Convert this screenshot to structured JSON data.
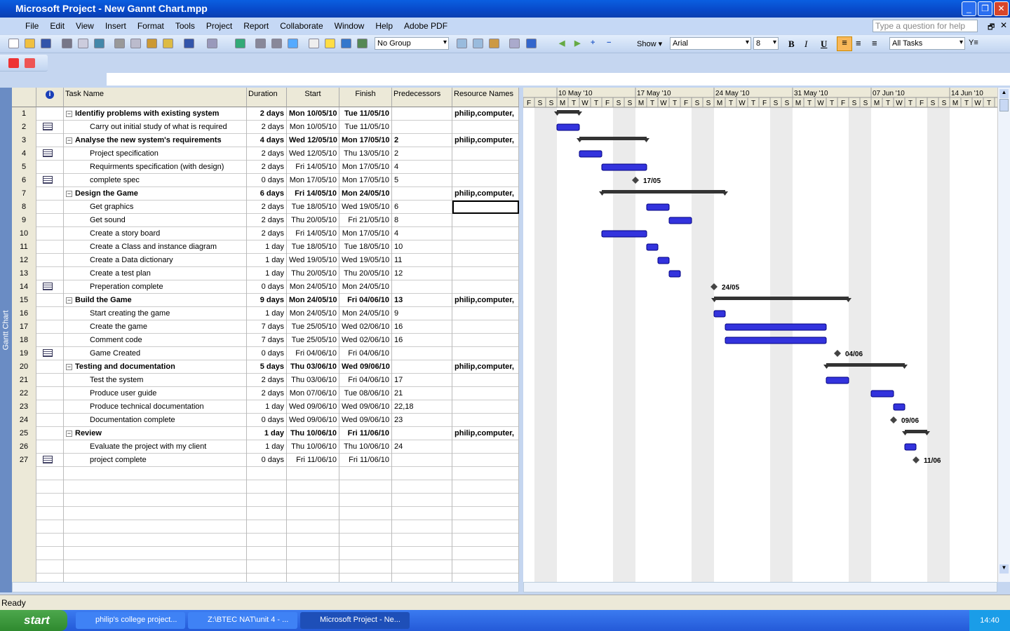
{
  "window": {
    "title": "Microsoft Project - New Gannt Chart.mpp"
  },
  "menu": [
    "File",
    "Edit",
    "View",
    "Insert",
    "Format",
    "Tools",
    "Project",
    "Report",
    "Collaborate",
    "Window",
    "Help",
    "Adobe PDF"
  ],
  "help_placeholder": "Type a question for help",
  "toolbar": {
    "group": "No Group",
    "show": "Show ▾",
    "font": "Arial",
    "size": "8",
    "bold": "B",
    "italic": "I",
    "underline": "U",
    "filter": "All Tasks"
  },
  "side_label": "Gantt Chart",
  "columns": [
    "Task Name",
    "Duration",
    "Start",
    "Finish",
    "Predecessors",
    "Resource Names"
  ],
  "timescale": {
    "weeks": [
      "10 May '10",
      "17 May '10",
      "24 May '10",
      "31 May '10",
      "07 Jun '10",
      "14 Jun '10"
    ],
    "days": "FSSMTWTFSSMTWTFSSMTWTFSSMTWTFSSMTWTFSSMTWTF"
  },
  "tasks": [
    {
      "id": "1",
      "name": "Identifiy problems with existing system",
      "dur": "2 days",
      "start": "Mon 10/05/10",
      "finish": "Tue 11/05/10",
      "pred": "",
      "res": "philip,computer,",
      "summary": true
    },
    {
      "id": "2",
      "name": "Carry out initial study of what is required",
      "dur": "2 days",
      "start": "Mon 10/05/10",
      "finish": "Tue 11/05/10",
      "pred": "",
      "res": "",
      "note": true
    },
    {
      "id": "3",
      "name": "Analyse the new system's requirements",
      "dur": "4 days",
      "start": "Wed 12/05/10",
      "finish": "Mon 17/05/10",
      "pred": "2",
      "res": "philip,computer,",
      "summary": true
    },
    {
      "id": "4",
      "name": "Project specification",
      "dur": "2 days",
      "start": "Wed 12/05/10",
      "finish": "Thu 13/05/10",
      "pred": "2",
      "res": "",
      "note": true
    },
    {
      "id": "5",
      "name": "Requirments specification (with design)",
      "dur": "2 days",
      "start": "Fri 14/05/10",
      "finish": "Mon 17/05/10",
      "pred": "4",
      "res": ""
    },
    {
      "id": "6",
      "name": "complete spec",
      "dur": "0 days",
      "start": "Mon 17/05/10",
      "finish": "Mon 17/05/10",
      "pred": "5",
      "res": "",
      "note": true,
      "ms": "17/05"
    },
    {
      "id": "7",
      "name": "Design the Game",
      "dur": "6 days",
      "start": "Fri 14/05/10",
      "finish": "Mon 24/05/10",
      "pred": "",
      "res": "philip,computer,",
      "summary": true
    },
    {
      "id": "8",
      "name": "Get graphics",
      "dur": "2 days",
      "start": "Tue 18/05/10",
      "finish": "Wed 19/05/10",
      "pred": "6",
      "res": ""
    },
    {
      "id": "9",
      "name": "Get sound",
      "dur": "2 days",
      "start": "Thu 20/05/10",
      "finish": "Fri 21/05/10",
      "pred": "8",
      "res": ""
    },
    {
      "id": "10",
      "name": "Create a story board",
      "dur": "2 days",
      "start": "Fri 14/05/10",
      "finish": "Mon 17/05/10",
      "pred": "4",
      "res": ""
    },
    {
      "id": "11",
      "name": "Create a Class and instance diagram",
      "dur": "1 day",
      "start": "Tue 18/05/10",
      "finish": "Tue 18/05/10",
      "pred": "10",
      "res": ""
    },
    {
      "id": "12",
      "name": "Create a Data dictionary",
      "dur": "1 day",
      "start": "Wed 19/05/10",
      "finish": "Wed 19/05/10",
      "pred": "11",
      "res": ""
    },
    {
      "id": "13",
      "name": "Create a test plan",
      "dur": "1 day",
      "start": "Thu 20/05/10",
      "finish": "Thu 20/05/10",
      "pred": "12",
      "res": ""
    },
    {
      "id": "14",
      "name": "Preperation complete",
      "dur": "0 days",
      "start": "Mon 24/05/10",
      "finish": "Mon 24/05/10",
      "pred": "",
      "res": "",
      "note": true,
      "ms": "24/05"
    },
    {
      "id": "15",
      "name": "Build the Game",
      "dur": "9 days",
      "start": "Mon 24/05/10",
      "finish": "Fri 04/06/10",
      "pred": "13",
      "res": "philip,computer,",
      "summary": true
    },
    {
      "id": "16",
      "name": "Start creating the game",
      "dur": "1 day",
      "start": "Mon 24/05/10",
      "finish": "Mon 24/05/10",
      "pred": "9",
      "res": ""
    },
    {
      "id": "17",
      "name": "Create the game",
      "dur": "7 days",
      "start": "Tue 25/05/10",
      "finish": "Wed 02/06/10",
      "pred": "16",
      "res": ""
    },
    {
      "id": "18",
      "name": "Comment code",
      "dur": "7 days",
      "start": "Tue 25/05/10",
      "finish": "Wed 02/06/10",
      "pred": "16",
      "res": ""
    },
    {
      "id": "19",
      "name": "Game Created",
      "dur": "0 days",
      "start": "Fri 04/06/10",
      "finish": "Fri 04/06/10",
      "pred": "",
      "res": "",
      "note": true,
      "ms": "04/06"
    },
    {
      "id": "20",
      "name": "Testing and documentation",
      "dur": "5 days",
      "start": "Thu 03/06/10",
      "finish": "Wed 09/06/10",
      "pred": "",
      "res": "philip,computer,",
      "summary": true
    },
    {
      "id": "21",
      "name": "Test the system",
      "dur": "2 days",
      "start": "Thu 03/06/10",
      "finish": "Fri 04/06/10",
      "pred": "17",
      "res": ""
    },
    {
      "id": "22",
      "name": "Produce user guide",
      "dur": "2 days",
      "start": "Mon 07/06/10",
      "finish": "Tue 08/06/10",
      "pred": "21",
      "res": ""
    },
    {
      "id": "23",
      "name": "Produce technical documentation",
      "dur": "1 day",
      "start": "Wed 09/06/10",
      "finish": "Wed 09/06/10",
      "pred": "22,18",
      "res": ""
    },
    {
      "id": "24",
      "name": "Documentation complete",
      "dur": "0 days",
      "start": "Wed 09/06/10",
      "finish": "Wed 09/06/10",
      "pred": "23",
      "res": "",
      "ms": "09/06"
    },
    {
      "id": "25",
      "name": "Review",
      "dur": "1 day",
      "start": "Thu 10/06/10",
      "finish": "Fri 11/06/10",
      "pred": "",
      "res": "philip,computer,",
      "summary": true
    },
    {
      "id": "26",
      "name": "Evaluate the project with my client",
      "dur": "1 day",
      "start": "Thu 10/06/10",
      "finish": "Thu 10/06/10",
      "pred": "24",
      "res": ""
    },
    {
      "id": "27",
      "name": "project complete",
      "dur": "0 days",
      "start": "Fri 11/06/10",
      "finish": "Fri 11/06/10",
      "pred": "",
      "res": "",
      "note": true,
      "ms": "11/06"
    }
  ],
  "colors": {
    "task_bar": "#3333dd",
    "summary_bar": "#333333",
    "weekend": "#d8d8d8"
  },
  "status": "Ready",
  "taskbar": {
    "start": "start",
    "items": [
      "philip's college project...",
      "Z:\\BTEC NAT\\unit 4 - ...",
      "Microsoft Project - Ne..."
    ],
    "clock": "14:40"
  }
}
